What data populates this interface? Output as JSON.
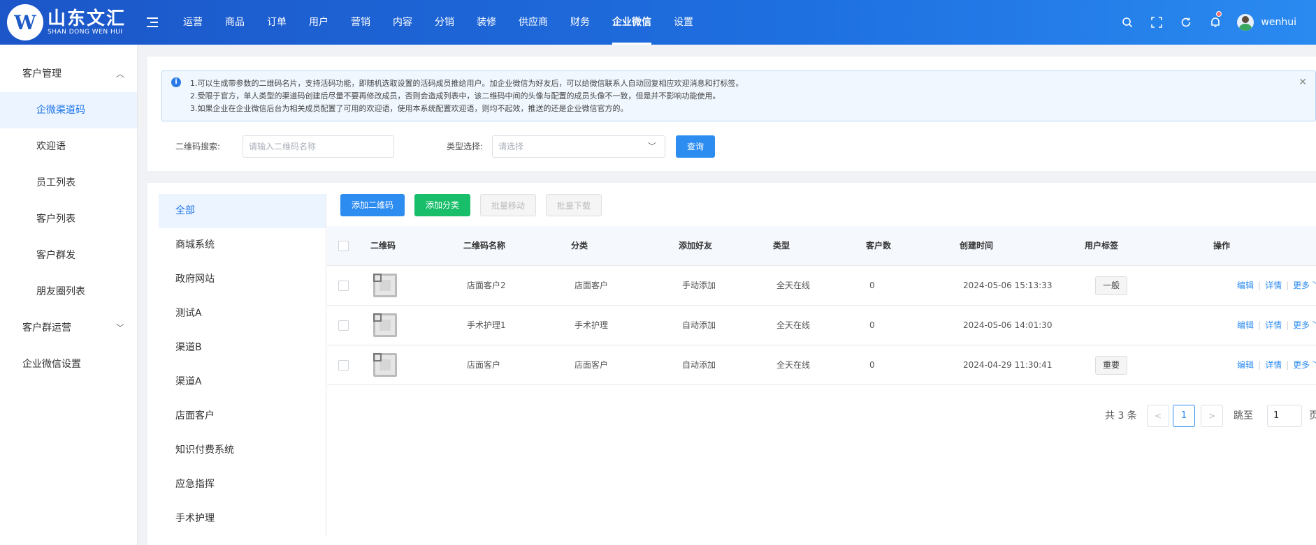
{
  "brand": {
    "logo_letter": "W",
    "name_cn": "山东文汇",
    "name_en": "SHAN DONG WEN HUI"
  },
  "nav": [
    "运营",
    "商品",
    "订单",
    "用户",
    "营销",
    "内容",
    "分销",
    "装修",
    "供应商",
    "财务",
    "企业微信",
    "设置"
  ],
  "nav_active": "企业微信",
  "user": {
    "name": "wenhui"
  },
  "sidebar": {
    "group1": "客户管理",
    "items": [
      "企微渠道码",
      "欢迎语",
      "员工列表",
      "客户列表",
      "客户群发",
      "朋友圈列表"
    ],
    "group2": "客户群运营",
    "group3": "企业微信设置"
  },
  "alert": {
    "line1": "1.可以生成带参数的二维码名片，支持活码功能，即随机选取设置的活码成员推给用户。加企业微信为好友后，可以给微信联系人自动回复相应欢迎消息和打标签。",
    "line2": "2.受限于官方，单人类型的渠道码创建后尽量不要再修改成员，否则会造成列表中，该二维码中间的头像与配置的成员头像不一致，但是并不影响功能使用。",
    "line3": "3.如果企业在企业微信后台为相关成员配置了可用的欢迎语，使用本系统配置欢迎语，则均不起效，推送的还是企业微信官方的。"
  },
  "filter": {
    "qr_label": "二维码搜索:",
    "qr_placeholder": "请输入二维码名称",
    "type_label": "类型选择:",
    "type_placeholder": "请选择",
    "query_btn": "查询"
  },
  "categories": [
    "全部",
    "商城系统",
    "政府网站",
    "测试A",
    "渠道B",
    "渠道A",
    "店面客户",
    "知识付费系统",
    "应急指挥",
    "手术护理"
  ],
  "toolbar": {
    "add_qr": "添加二维码",
    "add_cat": "添加分类",
    "batch_move": "批量移动",
    "batch_download": "批量下载"
  },
  "table": {
    "headers": [
      "二维码",
      "二维码名称",
      "分类",
      "添加好友",
      "类型",
      "客户数",
      "创建时间",
      "用户标签",
      "操作"
    ],
    "rows": [
      {
        "name": "店面客户2",
        "category": "店面客户",
        "add": "手动添加",
        "type": "全天在线",
        "count": "0",
        "created": "2024-05-06 15:13:33",
        "tag": "一般"
      },
      {
        "name": "手术护理1",
        "category": "手术护理",
        "add": "自动添加",
        "type": "全天在线",
        "count": "0",
        "created": "2024-05-06 14:01:30",
        "tag": ""
      },
      {
        "name": "店面客户",
        "category": "店面客户",
        "add": "自动添加",
        "type": "全天在线",
        "count": "0",
        "created": "2024-04-29 11:30:41",
        "tag": "重要"
      }
    ],
    "ops": {
      "edit": "编辑",
      "detail": "详情",
      "more": "更多"
    }
  },
  "pagination": {
    "total": "共 3 条",
    "current": "1",
    "jump_label": "跳至",
    "jump_value": "1",
    "page_suffix": "页"
  }
}
